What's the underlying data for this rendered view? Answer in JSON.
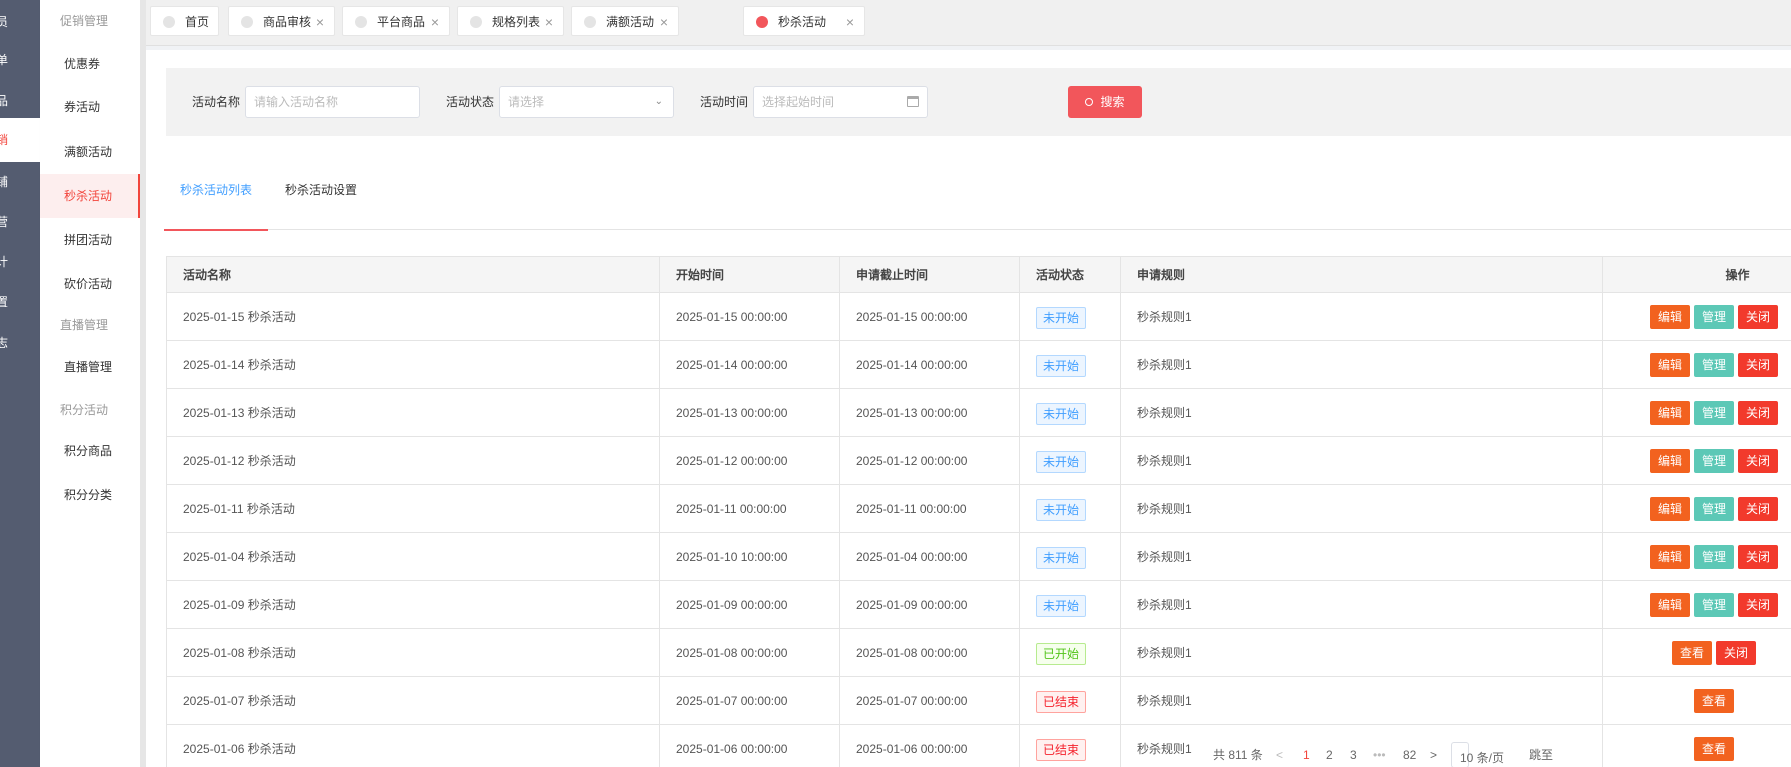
{
  "nav_primary": {
    "items": [
      {
        "label": "员",
        "active": false
      },
      {
        "label": "单",
        "active": false
      },
      {
        "label": "品",
        "active": false
      },
      {
        "label": "销",
        "active": true
      },
      {
        "label": "铺",
        "active": false
      },
      {
        "label": "营",
        "active": false
      },
      {
        "label": "计",
        "active": false
      },
      {
        "label": "置",
        "active": false
      },
      {
        "label": "志",
        "active": false
      }
    ]
  },
  "nav_secondary": {
    "group1": "促销管理",
    "items1": [
      "优惠券",
      "券活动",
      "满额活动",
      "秒杀活动",
      "拼团活动",
      "砍价活动"
    ],
    "group2": "直播管理",
    "items2": [
      "直播管理"
    ],
    "group3": "积分活动",
    "items3": [
      "积分商品",
      "积分分类"
    ],
    "active": "秒杀活动"
  },
  "tabs": [
    {
      "label": "首页",
      "closable": false,
      "active": false
    },
    {
      "label": "商品审核",
      "closable": true,
      "active": false
    },
    {
      "label": "平台商品",
      "closable": true,
      "active": false
    },
    {
      "label": "规格列表",
      "closable": true,
      "active": false
    },
    {
      "label": "满额活动",
      "closable": true,
      "active": false
    },
    {
      "label": "秒杀活动",
      "closable": true,
      "active": true
    }
  ],
  "filter": {
    "name_label": "活动名称",
    "name_placeholder": "请输入活动名称",
    "status_label": "活动状态",
    "status_placeholder": "请选择",
    "time_label": "活动时间",
    "time_placeholder": "选择起始时间",
    "search_label": "搜索"
  },
  "subtabs": {
    "list": "秒杀活动列表",
    "settings": "秒杀活动设置"
  },
  "table": {
    "headers": [
      "活动名称",
      "开始时间",
      "申请截止时间",
      "活动状态",
      "申请规则",
      "操作"
    ],
    "rows": [
      {
        "name": "2025-01-15 秒杀活动",
        "start": "2025-01-15 00:00:00",
        "deadline": "2025-01-15 00:00:00",
        "status": "未开始",
        "rule": "秒杀规则1",
        "actions": [
          "编辑",
          "管理",
          "关闭"
        ]
      },
      {
        "name": "2025-01-14 秒杀活动",
        "start": "2025-01-14 00:00:00",
        "deadline": "2025-01-14 00:00:00",
        "status": "未开始",
        "rule": "秒杀规则1",
        "actions": [
          "编辑",
          "管理",
          "关闭"
        ]
      },
      {
        "name": "2025-01-13 秒杀活动",
        "start": "2025-01-13 00:00:00",
        "deadline": "2025-01-13 00:00:00",
        "status": "未开始",
        "rule": "秒杀规则1",
        "actions": [
          "编辑",
          "管理",
          "关闭"
        ]
      },
      {
        "name": "2025-01-12 秒杀活动",
        "start": "2025-01-12 00:00:00",
        "deadline": "2025-01-12 00:00:00",
        "status": "未开始",
        "rule": "秒杀规则1",
        "actions": [
          "编辑",
          "管理",
          "关闭"
        ]
      },
      {
        "name": "2025-01-11 秒杀活动",
        "start": "2025-01-11 00:00:00",
        "deadline": "2025-01-11 00:00:00",
        "status": "未开始",
        "rule": "秒杀规则1",
        "actions": [
          "编辑",
          "管理",
          "关闭"
        ]
      },
      {
        "name": "2025-01-04 秒杀活动",
        "start": "2025-01-10 10:00:00",
        "deadline": "2025-01-04 00:00:00",
        "status": "未开始",
        "rule": "秒杀规则1",
        "actions": [
          "编辑",
          "管理",
          "关闭"
        ]
      },
      {
        "name": "2025-01-09 秒杀活动",
        "start": "2025-01-09 00:00:00",
        "deadline": "2025-01-09 00:00:00",
        "status": "未开始",
        "rule": "秒杀规则1",
        "actions": [
          "编辑",
          "管理",
          "关闭"
        ]
      },
      {
        "name": "2025-01-08 秒杀活动",
        "start": "2025-01-08 00:00:00",
        "deadline": "2025-01-08 00:00:00",
        "status": "已开始",
        "rule": "秒杀规则1",
        "actions": [
          "查看",
          "关闭"
        ]
      },
      {
        "name": "2025-01-07 秒杀活动",
        "start": "2025-01-07 00:00:00",
        "deadline": "2025-01-07 00:00:00",
        "status": "已结束",
        "rule": "秒杀规则1",
        "actions": [
          "查看"
        ]
      },
      {
        "name": "2025-01-06 秒杀活动",
        "start": "2025-01-06 00:00:00",
        "deadline": "2025-01-06 00:00:00",
        "status": "已结束",
        "rule": "秒杀规则1",
        "actions": [
          "查看"
        ]
      }
    ]
  },
  "pagination": {
    "total_text": "共 811 条",
    "prev": "<",
    "pages": [
      "1",
      "2",
      "3",
      "•••",
      "82"
    ],
    "current": "1",
    "next": ">",
    "page_size": "10 条/页",
    "jump": "跳至"
  },
  "colors": {
    "accent": "#f2453c",
    "sidebar_dark": "#545c70",
    "btn_edit": "#f2621f",
    "btn_manage": "#5cc8b6",
    "btn_close": "#f23a2c"
  }
}
